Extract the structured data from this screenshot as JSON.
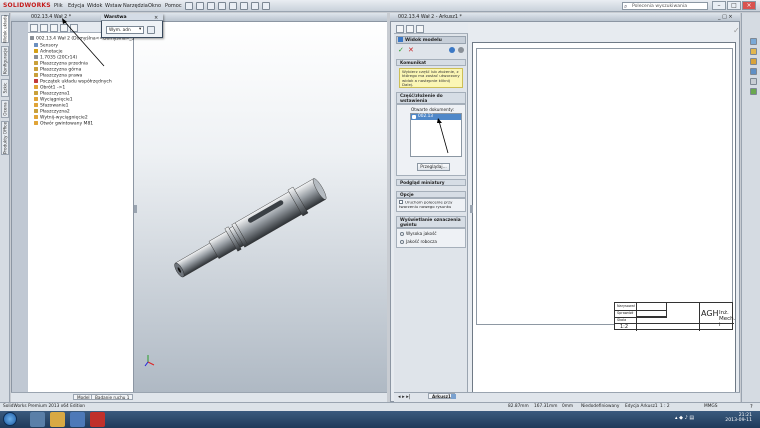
{
  "app": {
    "logo": "SOLIDWORKS",
    "menu": [
      "Plik",
      "Edycja",
      "Widok",
      "Wstaw",
      "Narzędzia",
      "Okno",
      "Pomoc"
    ],
    "search_placeholder": "Polecenia wyszukiwania",
    "status_left": "SolidWorks Premium 2013 x64 Edition",
    "status_right": {
      "x": "82.87mm",
      "y": "167.31mm",
      "z": "0mm",
      "state": "Niedodefiniowany",
      "edit": "Edycja Arkusz1",
      "scale": "1 : 2",
      "units": "MMGS"
    }
  },
  "left_tabs": [
    "Widok układu",
    "Konfiguracje",
    "Szkic",
    "Ocena",
    "Produkty Office"
  ],
  "left_window": {
    "title": "002.13.4 Wał 2 *",
    "tree_root": "002.13.4 Wał 2  (Domyślna<<Domyślna>_Stan",
    "tree": [
      {
        "label": "Sensory",
        "icon": "sensor-icon",
        "color": "#6b8fbf"
      },
      {
        "label": "Adnotacje",
        "icon": "annotation-icon",
        "color": "#d4a017"
      },
      {
        "label": "1.7035 (20Cr14)",
        "icon": "material-icon",
        "color": "#8a8f96"
      },
      {
        "label": "Płaszczyzna przednia",
        "icon": "plane-icon",
        "color": "#c9a03a"
      },
      {
        "label": "Płaszczyzna górna",
        "icon": "plane-icon",
        "color": "#c9a03a"
      },
      {
        "label": "Płaszczyzna prawa",
        "icon": "plane-icon",
        "color": "#c9a03a"
      },
      {
        "label": "Początek układu współrzędnych",
        "icon": "origin-icon",
        "color": "#c23b3b"
      },
      {
        "label": "Obrót1 ->1",
        "icon": "revolve-icon",
        "color": "#e0a437"
      },
      {
        "label": "Płaszczyzna1",
        "icon": "plane-icon",
        "color": "#c9a03a"
      },
      {
        "label": "Wyciągnięcie1",
        "icon": "extrude-icon",
        "color": "#e0a437"
      },
      {
        "label": "Sfazowanie1",
        "icon": "chamfer-icon",
        "color": "#e0a437"
      },
      {
        "label": "Płaszczyzna2",
        "icon": "plane-icon",
        "color": "#c9a03a"
      },
      {
        "label": "Wytnij-wyciągnięcie2",
        "icon": "cut-icon",
        "color": "#e0a437"
      },
      {
        "label": "Otwór gwintowany M81",
        "icon": "hole-icon",
        "color": "#e0a437"
      }
    ],
    "tabs": [
      "Model",
      "Badanie ruchu 1"
    ],
    "popup": {
      "title": "Warstwa",
      "value": "Wym. adn"
    }
  },
  "right_window": {
    "title": "002.13.4 Wał 2 - Arkusz1 *",
    "pm": {
      "title": "Widok modelu",
      "msg_header": "Komunikat",
      "msg_text": "Wybierz część lub złożenie, z którego ma zostać utworzony widok a następnie kliknij Dalej.",
      "part_header": "Część/złożenie do wstawienia",
      "open_docs_label": "Otwarte dokumenty:",
      "open_docs": [
        "002.13"
      ],
      "browse_button": "Przeglądaj...",
      "thumb_header": "Podgląd miniatury",
      "options_header": "Opcje",
      "options_chk": "Uruchom polecenie przy tworzeniu nowego rysunku",
      "cosmetic_header": "Wyświetlanie oznaczenia gwintu",
      "cosmetic_high": "Wysoka jakość",
      "cosmetic_draft": "Jakość robocza"
    },
    "sheet_tab": "Arkusz1",
    "title_block": {
      "left_labels": [
        "Narysował",
        "Sprawdził",
        "Skala"
      ],
      "scale": "1:2",
      "logo": "AGH",
      "dept": "Inż. Mech. i"
    }
  },
  "taskbar": {
    "time": "21:21",
    "date": "2013-09-11"
  }
}
